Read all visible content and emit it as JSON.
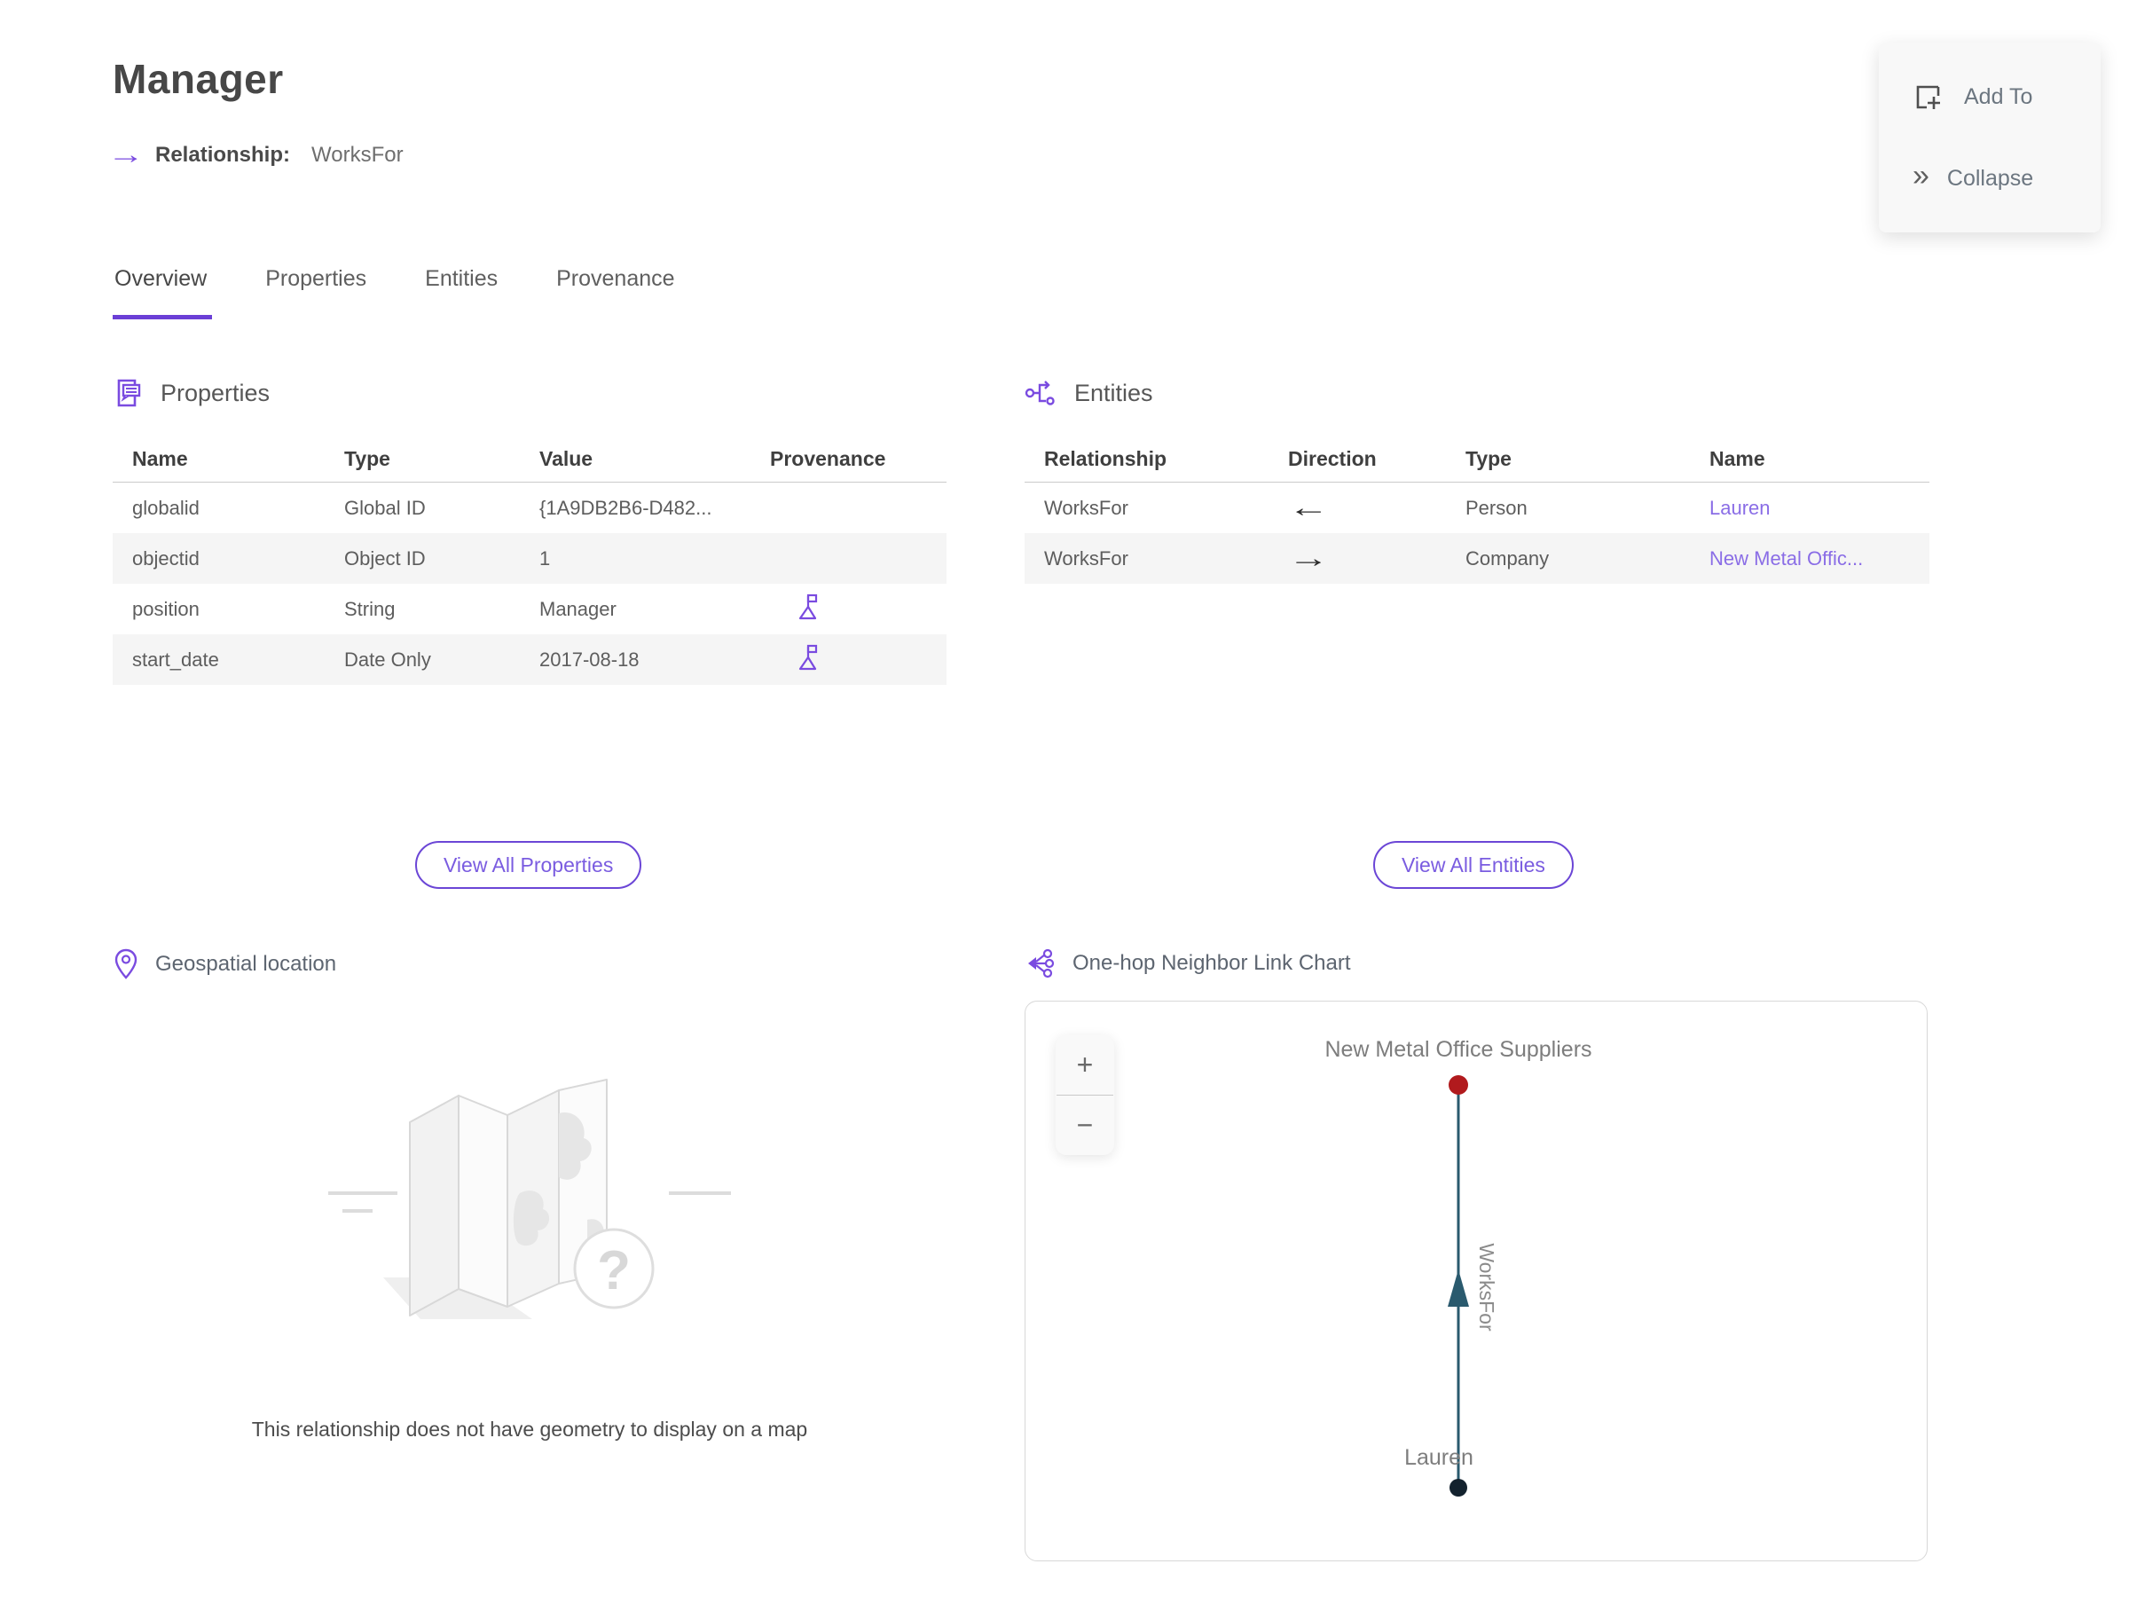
{
  "page": {
    "title": "Manager",
    "subtitle_label": "Relationship:",
    "subtitle_value": "WorksFor"
  },
  "actions": {
    "add_to": "Add To",
    "collapse": "Collapse"
  },
  "tabs": [
    {
      "label": "Overview",
      "active": true
    },
    {
      "label": "Properties",
      "active": false
    },
    {
      "label": "Entities",
      "active": false
    },
    {
      "label": "Provenance",
      "active": false
    }
  ],
  "properties_section": {
    "title": "Properties",
    "columns": [
      "Name",
      "Type",
      "Value",
      "Provenance"
    ],
    "rows": [
      {
        "name": "globalid",
        "type": "Global ID",
        "value": "{1A9DB2B6-D482...",
        "has_provenance_flag": false
      },
      {
        "name": "objectid",
        "type": "Object ID",
        "value": "1",
        "has_provenance_flag": false
      },
      {
        "name": "position",
        "type": "String",
        "value": "Manager",
        "has_provenance_flag": true
      },
      {
        "name": "start_date",
        "type": "Date Only",
        "value": "2017-08-18",
        "has_provenance_flag": true
      }
    ],
    "view_all_label": "View All Properties"
  },
  "entities_section": {
    "title": "Entities",
    "columns": [
      "Relationship",
      "Direction",
      "Type",
      "Name"
    ],
    "rows": [
      {
        "relationship": "WorksFor",
        "direction": "←",
        "type": "Person",
        "name": "Lauren"
      },
      {
        "relationship": "WorksFor",
        "direction": "→",
        "type": "Company",
        "name": "New Metal Offic..."
      }
    ],
    "view_all_label": "View All Entities"
  },
  "geospatial_section": {
    "title": "Geospatial location",
    "empty_message": "This relationship does not have geometry to display on a map"
  },
  "link_chart_section": {
    "title": "One-hop Neighbor Link Chart",
    "zoom_in_label": "+",
    "zoom_out_label": "−",
    "chart": {
      "top_node": {
        "label": "New Metal Office Suppliers",
        "color": "#b11a1d"
      },
      "bottom_node": {
        "label": "Lauren",
        "color": "#13222e"
      },
      "edge": {
        "label": "WorksFor",
        "color": "#2a5a6e",
        "direction": "up"
      }
    }
  },
  "colors": {
    "accent_purple": "#6b3fd6",
    "link_purple": "#8a6de6",
    "icon_purple": "#7a4be0",
    "row_stripe": "#f5f5f5",
    "edge_teal": "#2a5a6e",
    "node_red": "#b11a1d",
    "node_navy": "#13222e"
  }
}
